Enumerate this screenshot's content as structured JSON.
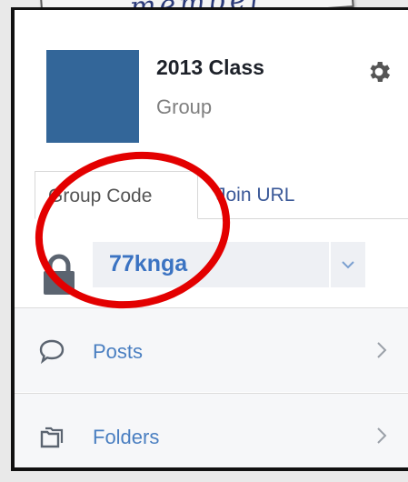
{
  "callout": {
    "text": "member"
  },
  "group": {
    "name": "2013 Class",
    "type": "Group",
    "avatar_color": "#336699"
  },
  "tabs": [
    {
      "label": "Group Code",
      "active": true
    },
    {
      "label": "Join URL",
      "active": false
    }
  ],
  "code": {
    "value": "77knga"
  },
  "menu": [
    {
      "label": "Posts",
      "icon": "chat-bubble-icon"
    },
    {
      "label": "Folders",
      "icon": "folders-icon"
    }
  ],
  "colors": {
    "accent": "#3b73c2",
    "link": "#4a7fc1",
    "annotation": "#e30000"
  }
}
